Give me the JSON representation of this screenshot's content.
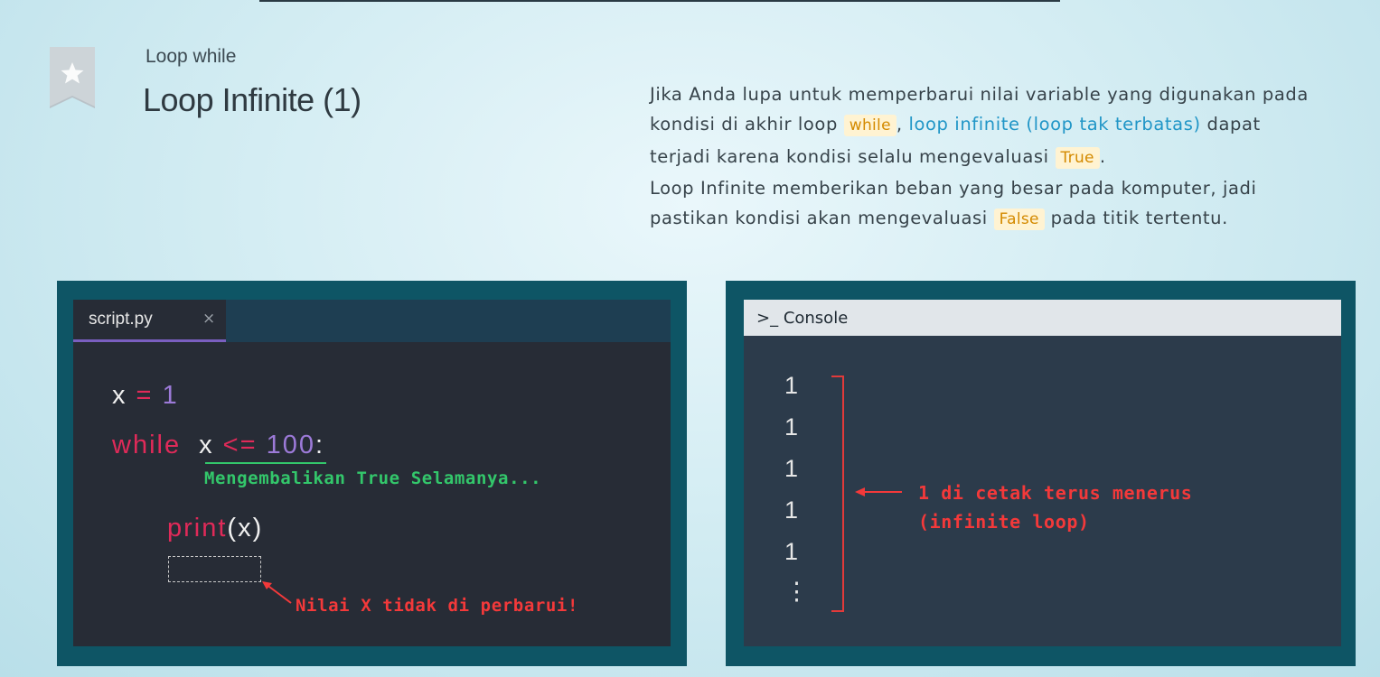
{
  "header": {
    "subtitle": "Loop while",
    "title": "Loop Infinite (1)",
    "bookmark_icon": "star-bookmark-icon"
  },
  "description": {
    "p1_text1": "Jika Anda lupa untuk memperbarui nilai variable yang digunakan pada",
    "p1_text2": "kondisi di akhir loop ",
    "p1_code1": "while",
    "p1_text3": ", ",
    "p1_link": "loop infinite (loop tak terbatas)",
    "p1_text4": " dapat",
    "p1_text5": "terjadi karena kondisi selalu mengevaluasi ",
    "p1_code2": "True",
    "p1_text6": ".",
    "p2_text1": "Loop Infinite memberikan beban yang besar pada komputer, jadi",
    "p2_text2": "pastikan kondisi akan mengevaluasi ",
    "p2_code": "False",
    "p2_text3": " pada titik tertentu."
  },
  "editor": {
    "tab_label": "script.py",
    "tab_close": "×",
    "line1": {
      "var": "x",
      "op": " = ",
      "num": "1"
    },
    "line2": {
      "kw": "while",
      "var": "x",
      "op": " <= ",
      "num": "100",
      "colon": ":"
    },
    "line3": {
      "fn": "print",
      "open": "(",
      "arg": "x",
      "close": ")"
    },
    "annotation_green": "Mengembalikan True Selamanya...",
    "annotation_red": "Nilai X tidak di perbarui!"
  },
  "console": {
    "title": "Console",
    "prompt_icon": "terminal-prompt-icon",
    "outputs": [
      "1",
      "1",
      "1",
      "1",
      "1",
      "⋮"
    ],
    "annotation_line1": "1 di cetak terus menerus",
    "annotation_line2": "(infinite loop)"
  },
  "colors": {
    "panel_bg": "#0e5565",
    "editor_bg": "#272c36",
    "keyword": "#e02a59",
    "number": "#9c7ad8",
    "green_note": "#33c76b",
    "red_note": "#f3393a",
    "link": "#2196c7",
    "code_chip": "#d48a00"
  }
}
